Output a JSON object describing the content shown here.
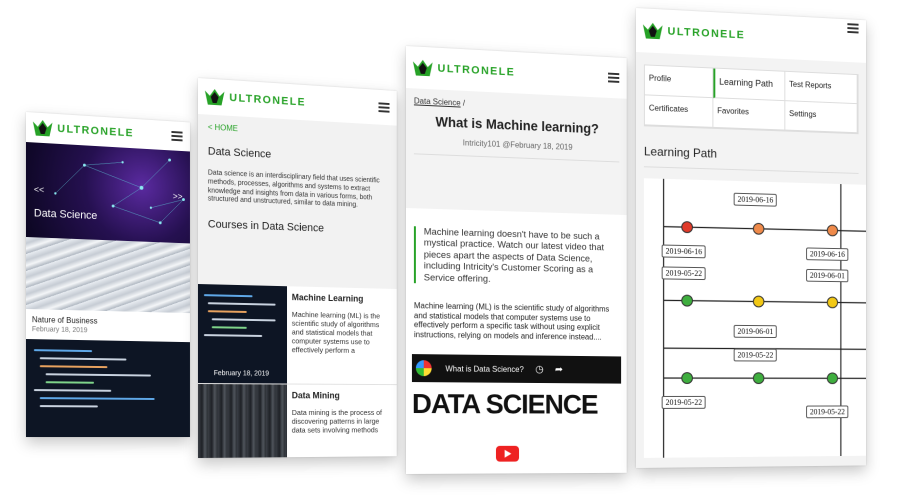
{
  "brand": {
    "name": "ULTRONELE",
    "color": "#27a227"
  },
  "phone1": {
    "hero_label": "Data Science",
    "prev_arrow": "<<",
    "next_arrow": ">>",
    "card_title": "Nature of Business",
    "card_date": "February 18, 2019"
  },
  "phone2": {
    "home_link": "< HOME",
    "title": "Data Science",
    "description": "Data science is an interdisciplinary field that uses scientific methods, processes, algorithms and systems to extract knowledge and insights from data in various forms, both structured and unstructured, similar to data mining.",
    "courses_heading": "Courses in Data Science",
    "courses": [
      {
        "title": "Machine Learning",
        "date": "February 18, 2019",
        "desc": "Machine learning (ML) is the scientific study of algorithms and statistical models that computer systems use to effectively perform a"
      },
      {
        "title": "Data Mining",
        "desc": "Data mining is the process of discovering patterns in large data sets involving methods"
      }
    ]
  },
  "phone3": {
    "breadcrumb": "Data Science",
    "breadcrumb_sep": "/",
    "title": "What is Machine learning?",
    "meta": "Intricity101 @February 18, 2019",
    "quote": "Machine learning doesn't have to be such a mystical practice. Watch our latest video that pieces apart the aspects of Data Science, including Intricity's Customer Scoring as a Service offering.",
    "body": "Machine learning (ML) is the scientific study of algorithms and statistical models that computer systems use to effectively perform a specific task without using explicit instructions, relying on models and inference instead....",
    "video_title": "What is Data Science?",
    "video_banner": "DATA SCIENCE"
  },
  "phone4": {
    "menu": [
      "Profile",
      "Learning Path",
      "Test Reports",
      "Certificates",
      "Favorites",
      "Settings"
    ],
    "heading": "Learning Path",
    "dates": {
      "d1": "2019-06-16",
      "d2": "2019-06-16",
      "d3": "2019-06-16",
      "d4": "2019-05-22",
      "d5": "2019-06-01",
      "d6": "2019-06-01",
      "d7": "2019-05-22",
      "d8": "2019-05-22",
      "d9": "2019-05-22"
    },
    "status_colors": {
      "red": "#e03a2a",
      "orange": "#ef8a4a",
      "yellow": "#f2c815",
      "green": "#3fae3f"
    }
  }
}
